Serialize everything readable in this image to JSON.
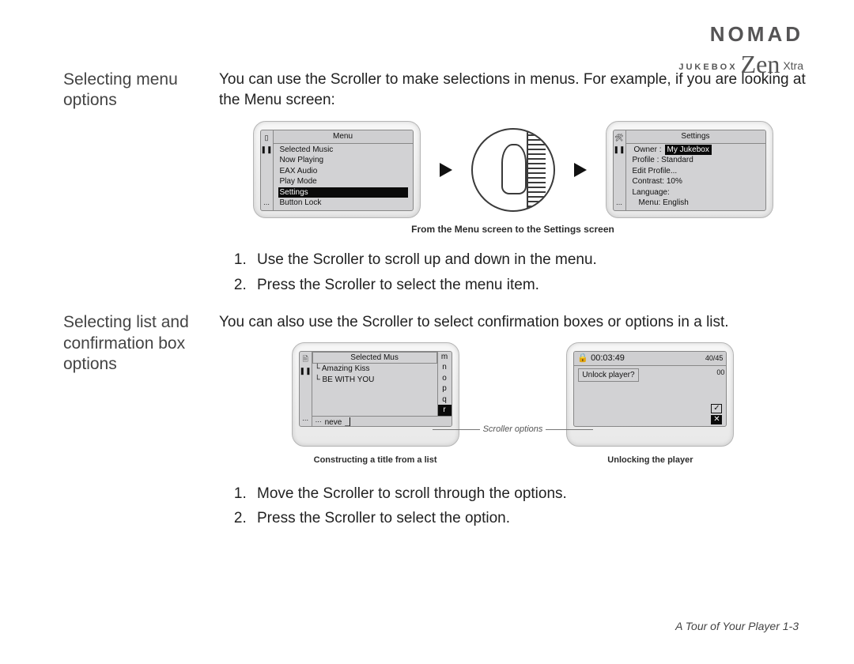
{
  "logo": {
    "line1": "NOMAD",
    "line2": "JUKEBOX",
    "zen": "Zen",
    "xtra": "Xtra"
  },
  "section1": {
    "heading": "Selecting menu options",
    "intro": "You can use the Scroller to make selections in menus. For example, if you are looking at the Menu screen:",
    "caption": "From the Menu screen to the Settings screen",
    "steps": [
      "Use the Scroller to scroll up and down in the menu.",
      "Press the Scroller to select the menu item."
    ],
    "menuScreen": {
      "title": "Menu",
      "items": [
        "Selected Music",
        "Now Playing",
        "EAX Audio",
        "Play Mode",
        "Settings",
        "Button Lock"
      ],
      "selectedIndex": 4
    },
    "settingsScreen": {
      "title": "Settings",
      "ownerLabel": "Owner :",
      "ownerValue": "My Jukebox",
      "profile": "Profile : Standard",
      "editProfile": "Edit Profile...",
      "contrast": "Contrast:  10%",
      "languageLabel": "Language:",
      "languageValue": "Menu: English"
    }
  },
  "section2": {
    "heading": "Selecting list and confirmation box options",
    "intro": "You can also use the Scroller to select confirmation boxes or options in a list.",
    "scrollerLabel": "Scroller options",
    "captionLeft": "Constructing a title from a list",
    "captionRight": "Unlocking the player",
    "steps": [
      "Move the Scroller to scroll through the options.",
      "Press the Scroller to select the option."
    ],
    "listScreen": {
      "title": "Selected Mus",
      "songs": [
        "Amazing Kiss",
        "BE WITH YOU"
      ],
      "letters": [
        "m",
        "n",
        "o",
        "p",
        "q",
        "r"
      ],
      "letterSelectedIndex": 5,
      "entry": "neve"
    },
    "unlockScreen": {
      "time": "00:03:49",
      "counter": "40/45",
      "counterTail": "00",
      "prompt": "Unlock player?",
      "check": "✓",
      "x": "✕"
    }
  },
  "footer": "A Tour of Your Player 1-3"
}
